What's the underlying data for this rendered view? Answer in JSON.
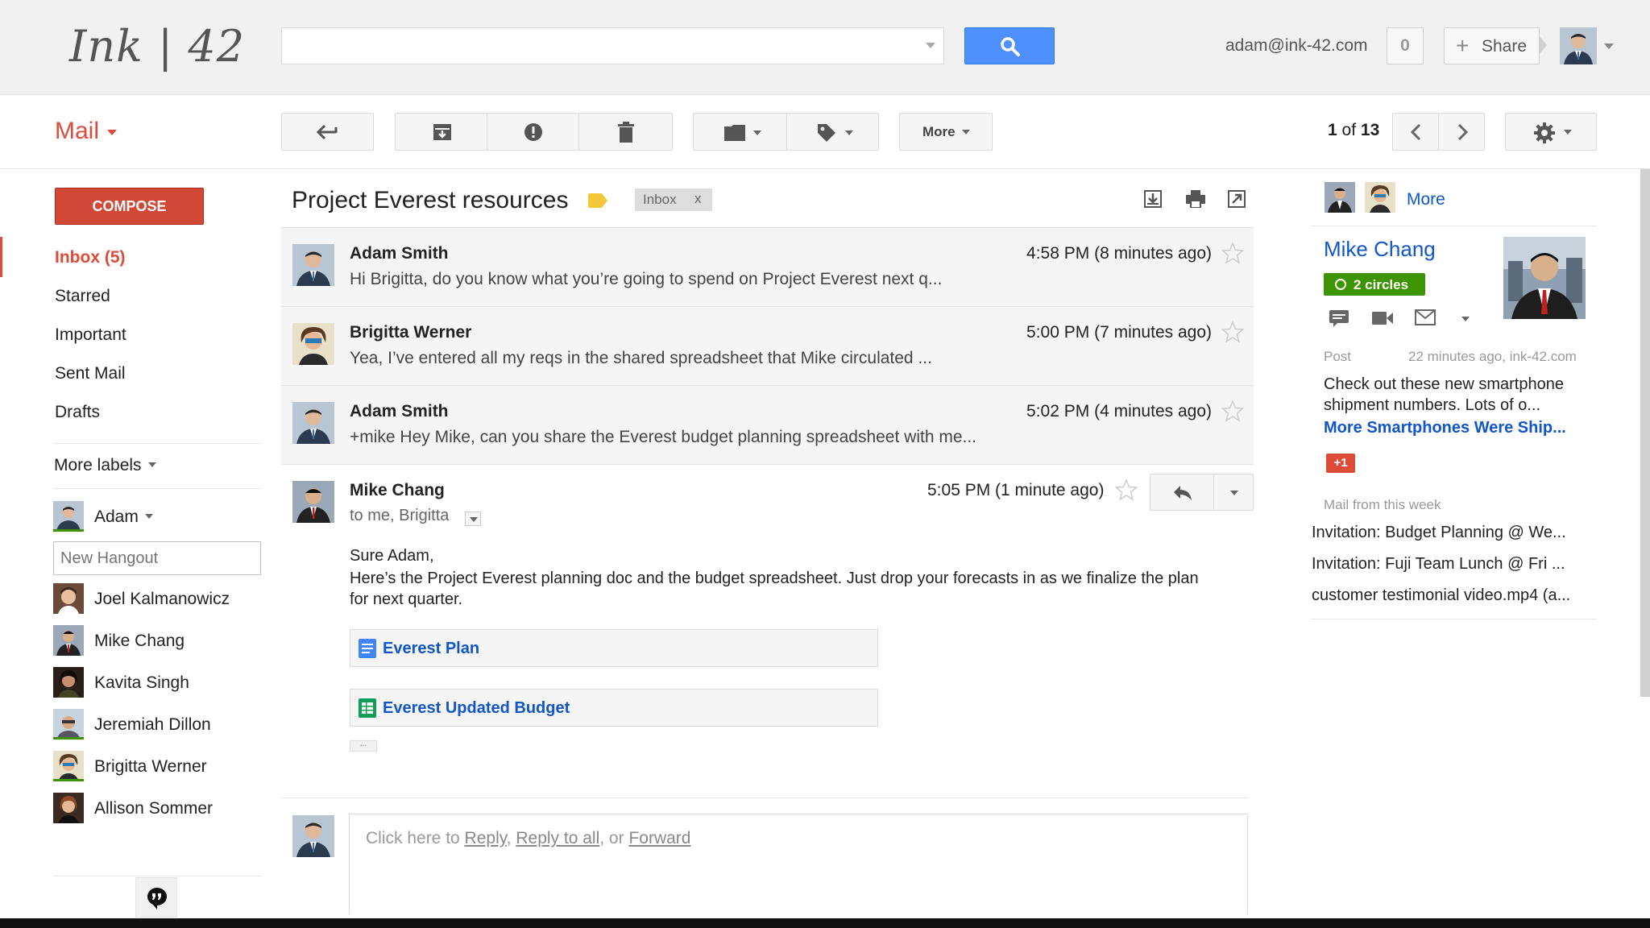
{
  "header": {
    "logo": "Ink | 42",
    "search": {
      "value": "",
      "placeholder": ""
    },
    "account_email": "adam@ink-42.com",
    "notification_count": "0",
    "share_label": "Share"
  },
  "toolbar": {
    "mail_label": "Mail",
    "more_label": "More",
    "page_current": "1",
    "page_of": "of",
    "page_total": "13"
  },
  "nav": {
    "compose_label": "COMPOSE",
    "items": [
      {
        "label": "Inbox (5)"
      },
      {
        "label": "Starred"
      },
      {
        "label": "Important"
      },
      {
        "label": "Sent Mail"
      },
      {
        "label": "Drafts"
      }
    ],
    "more_labels": "More labels"
  },
  "hangouts": {
    "me": "Adam",
    "new_placeholder": "New Hangout",
    "contacts": [
      {
        "name": "Joel Kalmanowicz"
      },
      {
        "name": "Mike Chang"
      },
      {
        "name": "Kavita Singh"
      },
      {
        "name": "Jeremiah Dillon"
      },
      {
        "name": "Brigitta Werner"
      },
      {
        "name": "Allison Sommer"
      }
    ]
  },
  "thread": {
    "title": "Project Everest resources",
    "label_chip": "Inbox",
    "label_chip_remove": "x",
    "messages": [
      {
        "from": "Adam Smith",
        "time": "4:58 PM (8 minutes ago)",
        "snippet": "Hi Brigitta, do you know what you’re going to spend on Project Everest next q..."
      },
      {
        "from": "Brigitta Werner",
        "time": "5:00 PM (7 minutes ago)",
        "snippet": "Yea, I’ve entered all my reqs in the shared spreadsheet that Mike circulated ..."
      },
      {
        "from": "Adam Smith",
        "time": "5:02 PM (4 minutes ago)",
        "snippet": "+mike Hey Mike, can you share the Everest budget planning spreadsheet with me..."
      }
    ],
    "open_message": {
      "from": "Mike Chang",
      "to": "to me, Brigitta",
      "time": "5:05 PM (1 minute ago)",
      "greeting": "Sure Adam,",
      "body": "Here’s the Project Everest planning doc and the budget spreadsheet. Just drop your forecasts in as we finalize the plan for next quarter.",
      "attachments": [
        {
          "name": "Everest Plan",
          "kind": "doc-icon",
          "color": "#4285f4"
        },
        {
          "name": "Everest Updated Budget",
          "kind": "sheet-icon",
          "color": "#0f9d58"
        }
      ],
      "trimmed": "..."
    },
    "reply": {
      "prefix": "Click here to ",
      "reply": "Reply",
      "sep1": ", ",
      "reply_all": "Reply to all",
      "sep2": ", or ",
      "forward": "Forward"
    }
  },
  "right_panel": {
    "more_label": "More",
    "contact_name": "Mike Chang",
    "circles": "2 circles",
    "post_label": "Post",
    "post_time": "22 minutes ago,  ink-42.com",
    "post_text": "Check out these new smartphone shipment numbers. Lots of o...",
    "post_link": "More Smartphones Were Ship...",
    "plus_one": "+1",
    "mail_heading": "Mail from this week",
    "mail_items": [
      {
        "subject": "Invitation: Budget Planning @ We..."
      },
      {
        "subject": "Invitation: Fuji Team Lunch @ Fri ..."
      },
      {
        "subject": "customer testimonial video.mp4 (a..."
      }
    ]
  },
  "colors": {
    "accent_red": "#dd4b39",
    "compose_red": "#d14836",
    "search_blue": "#4d90fe",
    "link_blue": "#1155cc",
    "circles_green": "#3d9400"
  }
}
